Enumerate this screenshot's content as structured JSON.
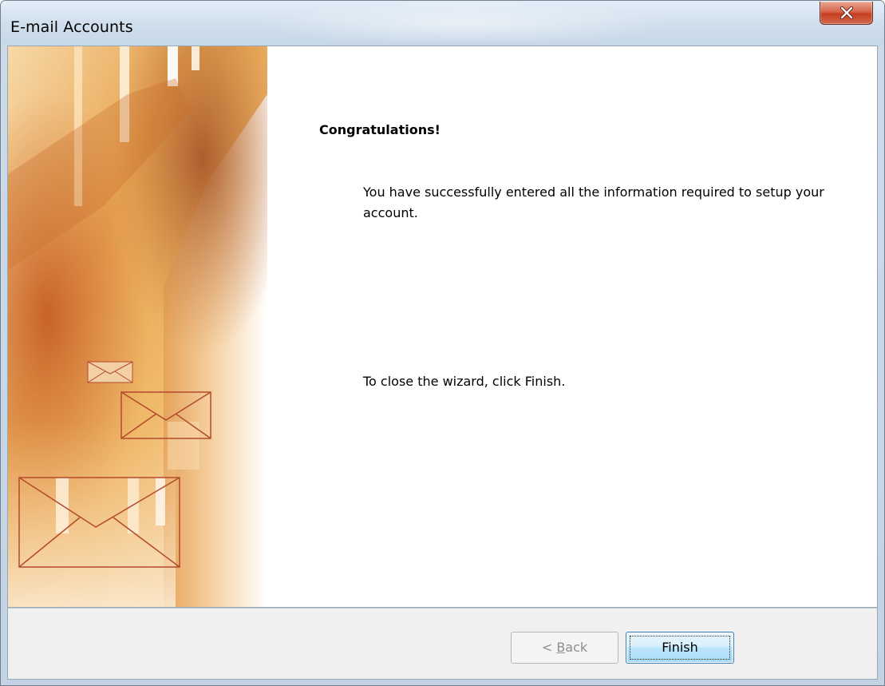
{
  "window": {
    "title": "E-mail Accounts"
  },
  "content": {
    "heading": "Congratulations!",
    "message": "You have successfully entered all the information required to setup your account.",
    "close_instruction": "To close the wizard, click Finish."
  },
  "buttons": {
    "back_label_prefix": "< ",
    "back_label_mnemonic": "B",
    "back_label_rest": "ack",
    "finish_label": "Finish"
  },
  "icons": {
    "close": "close-icon",
    "banner_envelopes": "envelope-icon"
  },
  "colors": {
    "banner_orange": "#e0903a",
    "close_red": "#c43d1f",
    "default_button_border": "#3c7fb1"
  }
}
